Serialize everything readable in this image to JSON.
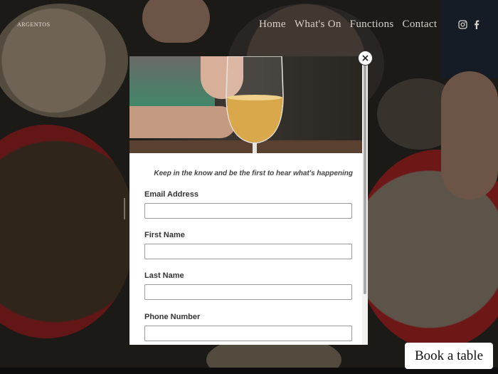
{
  "nav": {
    "logo": "ARGENTOS",
    "items": [
      {
        "label": "Home"
      },
      {
        "label": "What's On"
      },
      {
        "label": "Functions"
      },
      {
        "label": "Contact"
      }
    ],
    "social": [
      "instagram-icon",
      "facebook-icon"
    ]
  },
  "modal": {
    "tagline": "Keep in the know and be the first to hear what's happening",
    "close_icon": "close-icon",
    "fields": [
      {
        "label": "Email Address",
        "value": "",
        "placeholder": ""
      },
      {
        "label": "First Name",
        "value": "",
        "placeholder": ""
      },
      {
        "label": "Last Name",
        "value": "",
        "placeholder": ""
      },
      {
        "label": "Phone Number",
        "value": "",
        "placeholder": ""
      }
    ]
  },
  "cta": {
    "book_label": "Book a table"
  },
  "colors": {
    "overlay": "#000000",
    "modal_bg": "#ffffff",
    "text": "#333333",
    "wine": "#d9a84a"
  }
}
